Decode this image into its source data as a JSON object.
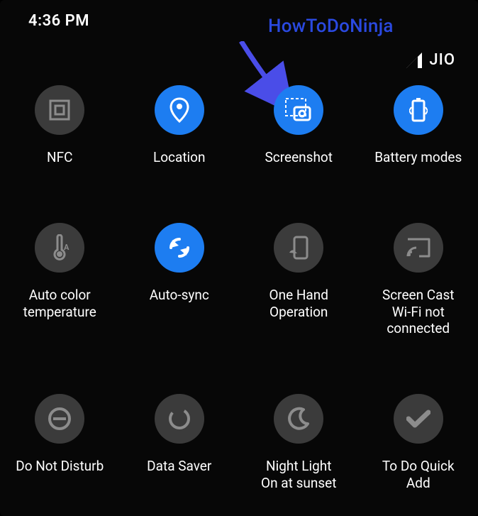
{
  "status_bar": {
    "time": "4:36 PM",
    "carrier": "JIO"
  },
  "annotation": {
    "label": "HowToDoNinja"
  },
  "tiles": [
    {
      "id": "nfc",
      "label": "NFC",
      "active": false
    },
    {
      "id": "location",
      "label": "Location",
      "active": true
    },
    {
      "id": "screenshot",
      "label": "Screenshot",
      "active": true
    },
    {
      "id": "battery-modes",
      "label": "Battery modes",
      "active": true
    },
    {
      "id": "auto-color-temp",
      "label": "Auto color\ntemperature",
      "active": false
    },
    {
      "id": "auto-sync",
      "label": "Auto-sync",
      "active": true
    },
    {
      "id": "one-hand",
      "label": "One Hand\nOperation",
      "active": false
    },
    {
      "id": "screen-cast",
      "label": "Screen Cast\nWi-Fi not connected",
      "active": false
    },
    {
      "id": "dnd",
      "label": "Do Not Disturb",
      "active": false
    },
    {
      "id": "data-saver",
      "label": "Data Saver",
      "active": false
    },
    {
      "id": "night-light",
      "label": "Night Light\nOn at sunset",
      "active": false
    },
    {
      "id": "todo-quick-add",
      "label": "To Do Quick\nAdd",
      "active": false
    }
  ]
}
